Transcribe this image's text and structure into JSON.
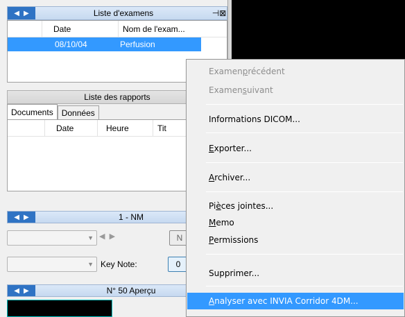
{
  "exams_panel": {
    "title": "Liste d'examens",
    "columns": [
      "Date",
      "Nom de l'exam..."
    ],
    "rows": [
      {
        "date": "08/10/04",
        "name": "Perfusion"
      }
    ]
  },
  "reports_panel": {
    "title": "Liste des rapports",
    "tabs": [
      "Documents",
      "Données"
    ],
    "columns": [
      "Date",
      "Heure",
      "Tit"
    ]
  },
  "series_panel": {
    "title": "1 - NM",
    "key_note_label": "Key Note:",
    "btn1_text": "N",
    "btn2_text": "0"
  },
  "preview_panel": {
    "title": "N° 50 Aperçu"
  },
  "context_menu": {
    "items": [
      {
        "pre": "Examen ",
        "u": "p",
        "post": "récédent",
        "disabled": true
      },
      {
        "pre": "Examen ",
        "u": "s",
        "post": "uivant",
        "disabled": true
      },
      {
        "pre": "",
        "u": "",
        "post": "Informations DICOM...",
        "disabled": false
      },
      {
        "pre": "",
        "u": "E",
        "post": "xporter...",
        "disabled": false
      },
      {
        "pre": "",
        "u": "A",
        "post": "rchiver...",
        "disabled": false
      },
      {
        "pre": "Pi",
        "u": "è",
        "post": "ces jointes...",
        "disabled": false
      },
      {
        "pre": "",
        "u": "M",
        "post": "emo",
        "disabled": false
      },
      {
        "pre": "",
        "u": "P",
        "post": "ermissions",
        "disabled": false
      },
      {
        "pre": "",
        "u": "",
        "post": "Supprimer...",
        "disabled": false
      },
      {
        "pre": "",
        "u": "A",
        "post": "nalyser avec INVIA Corridor 4DM...",
        "disabled": false,
        "hover": true
      }
    ]
  }
}
